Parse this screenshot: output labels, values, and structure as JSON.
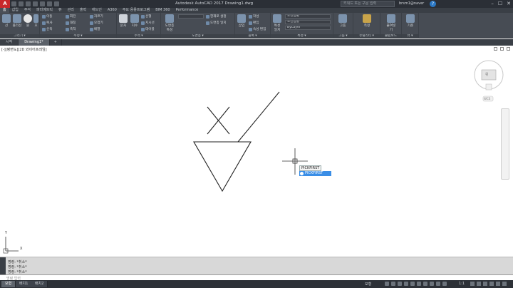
{
  "app": {
    "logo_letter": "A",
    "title": "Autodesk AutoCAD 2017   Drawing1.dwg",
    "search_placeholder": "키워드 또는 구문 입력",
    "user": "brsm1@naver",
    "help": "?",
    "window_controls": [
      "–",
      "☐",
      "✕"
    ]
  },
  "ribbon": {
    "tabs": [
      "홈",
      "삽입",
      "주석",
      "파라메트릭",
      "뷰",
      "관리",
      "출력",
      "애드인",
      "A360",
      "주요 응용프로그램",
      "BIM 360",
      "Performance"
    ],
    "active_tab": "홈",
    "panels": {
      "draw": {
        "title": "그리기 ▾",
        "tools": [
          "선",
          "폴리선",
          "원",
          "호"
        ]
      },
      "modify": {
        "title": "수정 ▾",
        "tools": [
          "이동",
          "회전",
          "자르기",
          "복사",
          "대칭",
          "모깎기",
          "신축",
          "축척",
          "배열"
        ]
      },
      "annotation": {
        "title": "주석 ▾",
        "tools": [
          "문자",
          "치수",
          "선형",
          "지시선",
          "테이블"
        ]
      },
      "layers": {
        "title": "도면층 ▾",
        "tools": [
          "도면층 특성",
          "현재로 설정",
          "도면층 일치"
        ]
      },
      "block": {
        "title": "블록 ▾",
        "tools": [
          "삽입",
          "작성",
          "편집",
          "속성 편집"
        ]
      },
      "properties": {
        "title": "특성 ▾",
        "tools": [
          "특성 일치"
        ],
        "combos": [
          "도면층별",
          "도면층별",
          "ByLayer"
        ]
      },
      "groups": {
        "title": "그룹 ▾",
        "tools": [
          "그룹"
        ]
      },
      "utilities": {
        "title": "유틸리티 ▾",
        "tools": [
          "측정"
        ]
      },
      "clipboard": {
        "title": "클립보드",
        "tools": [
          "붙여넣기"
        ]
      },
      "view": {
        "title": "뷰 ▾",
        "tools": [
          "기준"
        ]
      }
    }
  },
  "file_tabs": [
    "시작",
    "Drawing1*"
  ],
  "file_tab_plus": "+",
  "viewport": {
    "label": "[-][평면도][2D 와이어프레임]",
    "viewcube_top": "위",
    "wcs": "WCS",
    "ucs_x": "X",
    "ucs_y": "Y"
  },
  "cursor_tooltip": {
    "label": "PICKFIRST",
    "input_value": "PICKFIRST"
  },
  "command": {
    "history": [
      "명령: *취소*",
      "명령: *취소*",
      "명령: *취소*"
    ],
    "prompt_placeholder": "명령 입력"
  },
  "status": {
    "layout_tabs": [
      "모형",
      "배치1",
      "배치2"
    ],
    "model_label": "모형",
    "scale": "1:1"
  },
  "colors": {
    "titlebar": "#2b2f36",
    "ribbon": "#474c54",
    "canvas": "#ffffff",
    "accent": "#3a8ee6",
    "logo": "#c8282b"
  }
}
